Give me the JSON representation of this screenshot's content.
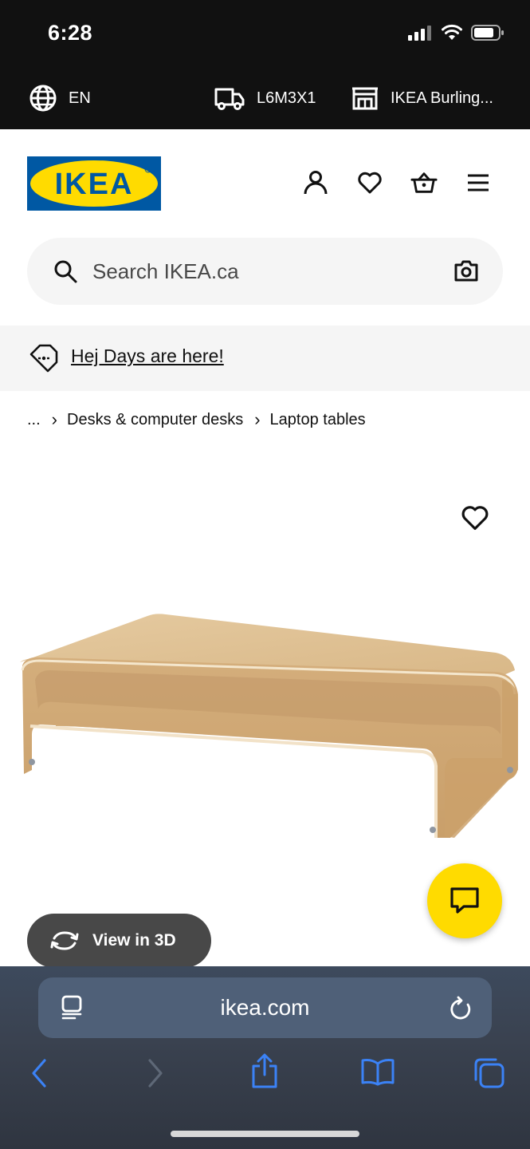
{
  "status_bar": {
    "time": "6:28"
  },
  "top_bar": {
    "language": "EN",
    "postal_code": "L6M3X1",
    "store": "IKEA Burling..."
  },
  "header": {
    "logo_text": "IKEA"
  },
  "search": {
    "placeholder": "Search IKEA.ca"
  },
  "promo": {
    "text": "Hej Days are here!"
  },
  "breadcrumb": {
    "ellipsis": "...",
    "items": [
      "Desks & computer desks",
      "Laptop tables"
    ]
  },
  "product": {
    "view_3d_label": "View in 3D"
  },
  "browser": {
    "url": "ikea.com"
  },
  "colors": {
    "ikea_blue": "#0058a3",
    "ikea_yellow": "#ffdb00",
    "safari_blue": "#3b82f6"
  }
}
